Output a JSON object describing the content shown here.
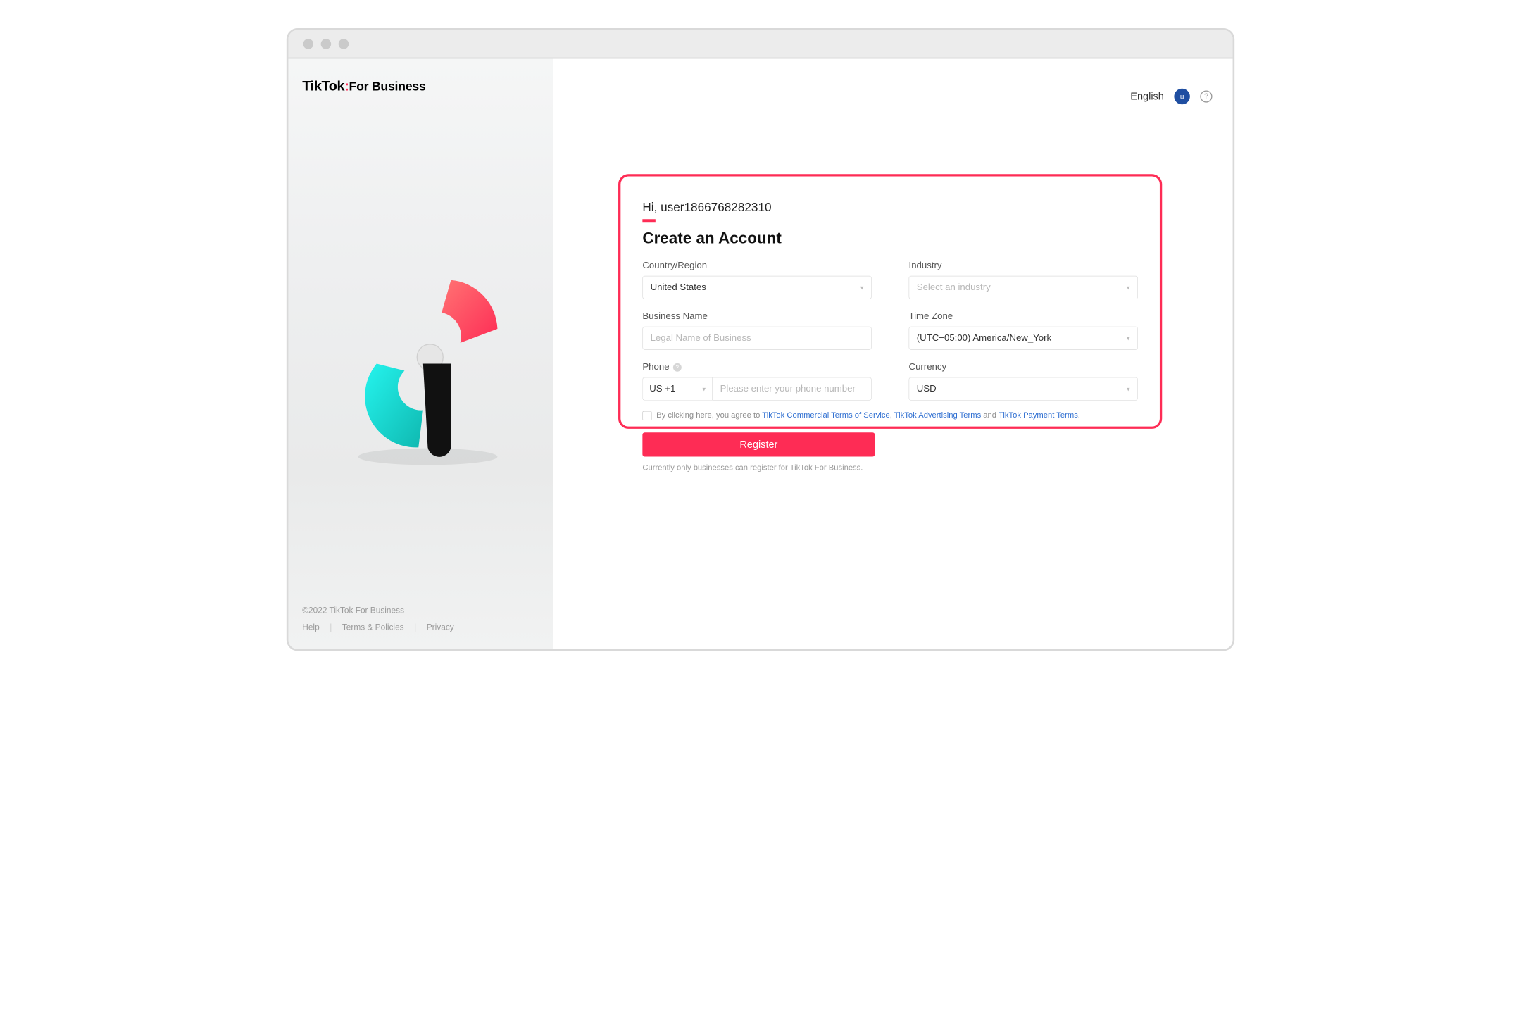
{
  "logo": {
    "main": "TikTok",
    "sub": "For Business"
  },
  "topbar": {
    "language": "English",
    "avatar_initial": "u"
  },
  "form": {
    "greeting": "Hi, user1866768282310",
    "title": "Create an Account",
    "labels": {
      "country": "Country/Region",
      "industry": "Industry",
      "business_name": "Business Name",
      "time_zone": "Time Zone",
      "phone": "Phone",
      "currency": "Currency"
    },
    "values": {
      "country": "United States",
      "time_zone": "(UTC−05:00) America/New_York",
      "phone_code": "US +1",
      "currency": "USD"
    },
    "placeholders": {
      "industry": "Select an industry",
      "business_name": "Legal Name of Business",
      "phone": "Please enter your phone number"
    },
    "agree": {
      "prefix": "By clicking here, you agree to ",
      "link1": "TikTok Commercial Terms of Service",
      "sep1": ", ",
      "link2": "TikTok Advertising Terms",
      "sep2": " and ",
      "link3": "TikTok Payment Terms",
      "suffix": "."
    },
    "register_label": "Register",
    "note": "Currently only businesses can register for TikTok For Business."
  },
  "footer": {
    "copyright": "©2022 TikTok For Business",
    "links": {
      "help": "Help",
      "terms": "Terms & Policies",
      "privacy": "Privacy"
    }
  }
}
